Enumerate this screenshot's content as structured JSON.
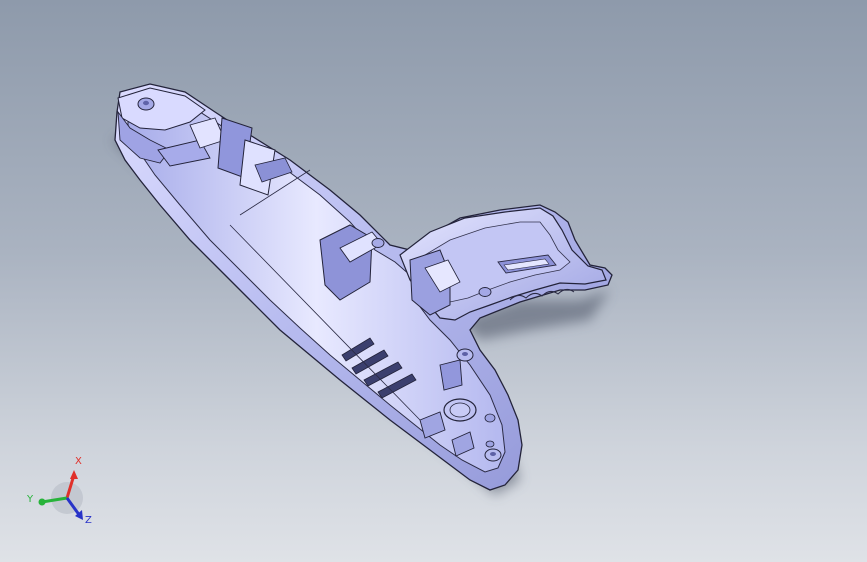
{
  "viewport": {
    "background_top": "#8e9aab",
    "background_bottom": "#dfe2e7",
    "part_color": "#c5c8f2",
    "edge_color": "#2b2b3a"
  },
  "model": {
    "part_name": "grinder-housing-half",
    "slots": [
      {
        "id": "vent-slot-1"
      },
      {
        "id": "vent-slot-2"
      },
      {
        "id": "vent-slot-3"
      },
      {
        "id": "vent-slot-4"
      }
    ]
  },
  "triad": {
    "x_label": "X",
    "y_label": "Y",
    "z_label": "Z",
    "x_color": "#e0302a",
    "y_color": "#27b33a",
    "z_color": "#2833c8"
  }
}
